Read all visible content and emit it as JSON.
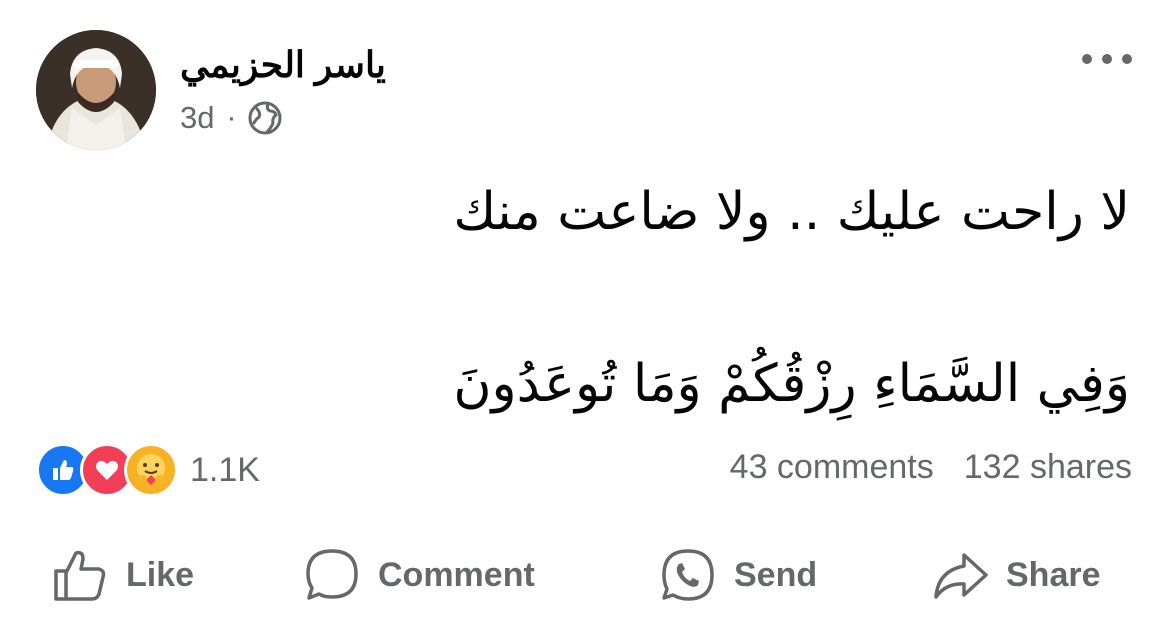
{
  "post": {
    "author": "ياسر الحزيمي",
    "time": "3d",
    "privacy_icon": "globe-icon",
    "text_line1": "لا راحت عليك .. ولا ضاعت منك",
    "text_line2": "وَفِي السَّمَاءِ رِزْقُكُمْ وَمَا تُوعَدُونَ"
  },
  "reactions": {
    "icons": [
      "like-icon",
      "love-icon",
      "care-icon"
    ],
    "count": "1.1K"
  },
  "stats": {
    "comments": "43 comments",
    "shares": "132 shares"
  },
  "actions": {
    "like": "Like",
    "comment": "Comment",
    "send": "Send",
    "share": "Share"
  },
  "colors": {
    "secondary_text": "#65676b",
    "like_blue": "#1877f2",
    "love_red": "#f33e58",
    "care_yellow": "#f7b125"
  }
}
